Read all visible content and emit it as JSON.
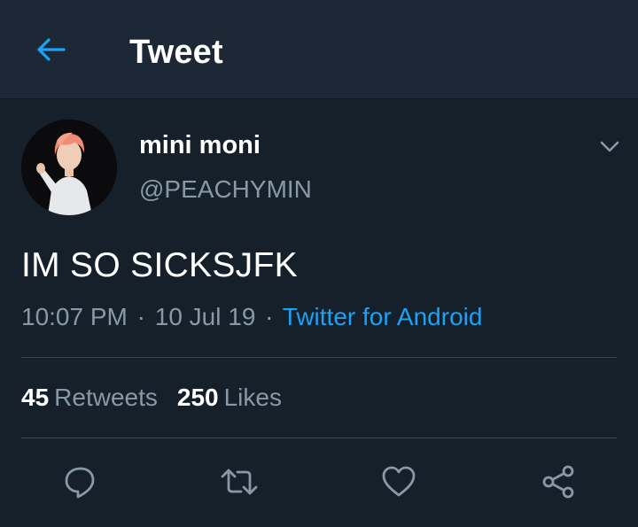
{
  "header": {
    "title": "Tweet",
    "back_icon": "arrow-left-icon"
  },
  "colors": {
    "background": "#15202b",
    "header_background": "#1c2836",
    "accent": "#1da1f2",
    "secondary_text": "#8899a6",
    "divider": "#38444d"
  },
  "tweet": {
    "display_name": "mini moni",
    "handle": "@PEACHYMIN",
    "text": "IM SO SICKSJFK",
    "time": "10:07 PM",
    "date": "10 Jul 19",
    "separator": "·",
    "source": "Twitter for Android"
  },
  "stats": {
    "retweets_count": "45",
    "retweets_label": "Retweets",
    "likes_count": "250",
    "likes_label": "Likes"
  },
  "actions": [
    "reply-icon",
    "retweet-icon",
    "like-icon",
    "share-icon"
  ]
}
